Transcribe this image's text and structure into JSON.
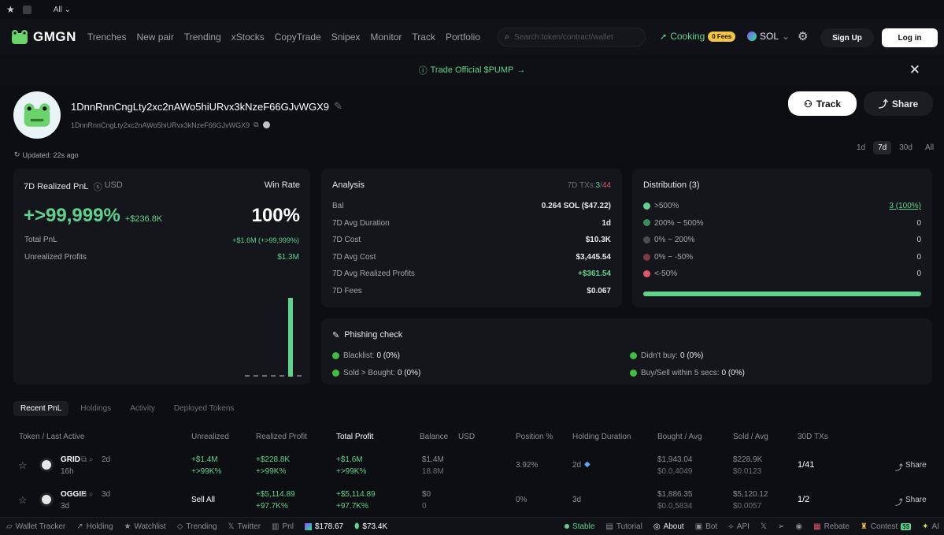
{
  "topstrip": {
    "filter": "All"
  },
  "nav": {
    "brand": "GMGN",
    "links": [
      "Trenches",
      "New pair",
      "Trending",
      "xStocks",
      "CopyTrade",
      "Snipex",
      "Monitor",
      "Track",
      "Portfolio"
    ],
    "search_placeholder": "Search token/contract/wallet",
    "cooking": "Cooking",
    "fees_badge": "0 Fees",
    "chain": "SOL",
    "signup": "Sign Up",
    "login": "Log in"
  },
  "banner": {
    "text": "Trade Official $PUMP"
  },
  "wallet": {
    "address": "1DnnRnnCngLty2xc2nAWo5hiURvx3kNzeF66GJvWGX9",
    "address_short": "1DnnRnnCngLty2xc2nAWo5hiURvx3kNzeF66GJvWGX9",
    "updated": "Updated: 22s ago",
    "track": "Track",
    "share": "Share"
  },
  "periods": [
    "1d",
    "7d",
    "30d",
    "All"
  ],
  "active_period": "7d",
  "pnl": {
    "title": "7D Realized PnL",
    "currency": "USD",
    "winrate_label": "Win Rate",
    "big": "+>99,999%",
    "big_sub": "+$236.8K",
    "winrate": "100%",
    "total_label": "Total PnL",
    "total_value": "+$1.6M (+>99,999%)",
    "unrealized_label": "Unrealized Profits",
    "unrealized_value": "$1.3M",
    "bars": [
      0.02,
      0.02,
      0.02,
      0.02,
      0.02,
      1,
      0.02
    ]
  },
  "analysis": {
    "title": "Analysis",
    "txs_label": "7D TXs:",
    "txs_buy": "3",
    "txs_sep": "/",
    "txs_sell": "44",
    "rows": [
      {
        "k": "Bal",
        "v": "0.264 SOL ($47.22)"
      },
      {
        "k": "7D Avg Duration",
        "v": "1d"
      },
      {
        "k": "7D Cost",
        "v": "$10.3K"
      },
      {
        "k": "7D Avg Cost",
        "v": "$3,445.54"
      },
      {
        "k": "7D Avg Realized Profits",
        "v": "+$361.54"
      },
      {
        "k": "7D Fees",
        "v": "$0.067"
      }
    ]
  },
  "distribution": {
    "title": "Distribution (3)",
    "rows": [
      {
        "k": ">500%",
        "v": "3 (100%)",
        "color": "#5fd38d"
      },
      {
        "k": "200% ~ 500%",
        "v": "0",
        "color": "#3f8a5c"
      },
      {
        "k": "0% ~ 200%",
        "v": "0",
        "color": "#4a4d55"
      },
      {
        "k": "0% ~ -50%",
        "v": "0",
        "color": "#7a3a45"
      },
      {
        "k": "<-50%",
        "v": "0",
        "color": "#e0556b"
      }
    ],
    "fill_fraction": 1.0
  },
  "phishing": {
    "title": "Phishing check",
    "items": [
      {
        "k": "Blacklist:",
        "v": "0 (0%)"
      },
      {
        "k": "Didn't buy:",
        "v": "0 (0%)"
      },
      {
        "k": "Sold > Bought:",
        "v": "0 (0%)"
      },
      {
        "k": "Buy/Sell within 5 secs:",
        "v": "0 (0%)"
      }
    ]
  },
  "tabs": [
    "Recent PnL",
    "Holdings",
    "Activity",
    "Deployed Tokens"
  ],
  "columns": [
    "Token / Last Active",
    "Unrealized",
    "Realized Profit",
    "Total Profit",
    "Balance",
    "USD",
    "Position %",
    "Holding Duration",
    "Bought / Avg",
    "Sold / Avg",
    "30D TXs"
  ],
  "rows": [
    {
      "token": "GRID",
      "age": "2d",
      "last": "16h",
      "unrealized": "+$1.4M",
      "unrealized_pct": "+>99K%",
      "realized": "+$228.8K",
      "realized_pct": "+>99K%",
      "total": "+$1.6M",
      "total_pct": "+>99K%",
      "balance": "$1.4M",
      "balance_sub": "18.8M",
      "position": "3.92%",
      "duration": "2d",
      "bought": "$1,943.04",
      "bought_avg": "$0.0,4049",
      "sold": "$228.9K",
      "sold_avg": "$0.0123",
      "txs": "1/41",
      "share": "Share"
    },
    {
      "token": "OGGIE",
      "age": "3d",
      "last": "3d",
      "unrealized": "Sell All",
      "unrealized_pct": "",
      "realized": "+$5,114.89",
      "realized_pct": "+97.7K%",
      "total": "+$5,114.89",
      "total_pct": "+97.7K%",
      "balance": "$0",
      "balance_sub": "0",
      "position": "0%",
      "duration": "3d",
      "bought": "$1,886.35",
      "bought_avg": "$0.0,5834",
      "sold": "$5,120.12",
      "sold_avg": "$0.0057",
      "txs": "1/2",
      "share": "Share"
    }
  ],
  "bottom": {
    "items": [
      "Wallet Tracker",
      "Holding",
      "Watchlist",
      "Trending",
      "Twitter",
      "Pnl"
    ],
    "sol_price": "$178.67",
    "stat2": "$73.4K",
    "stable": "Stable",
    "tutorial": "Tutorial",
    "about": "About",
    "bot": "Bot",
    "api": "API",
    "rebate": "Rebate",
    "contest": "Contest",
    "contest_badge": "$$",
    "ai": "AI"
  }
}
